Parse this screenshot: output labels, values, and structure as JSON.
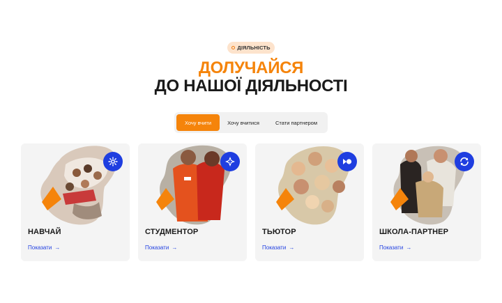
{
  "section": {
    "badge": "ДІЯЛЬНІСТЬ",
    "title_line1": "ДОЛУЧАЙСЯ",
    "title_line2": "ДО НАШОЇ ДІЯЛЬНОСТІ"
  },
  "tabs": [
    {
      "label": "Хочу вчити",
      "active": true
    },
    {
      "label": "Хочу вчитися",
      "active": false
    },
    {
      "label": "Стати партнером",
      "active": false
    }
  ],
  "cards": [
    {
      "title": "НАВЧАЙ",
      "link": "Показати",
      "icon": "flower-icon"
    },
    {
      "title": "СТУДМЕНТОР",
      "link": "Показати",
      "icon": "plus-star-icon"
    },
    {
      "title": "ТЬЮТОР",
      "link": "Показати",
      "icon": "bowtie-icon"
    },
    {
      "title": "ШКОЛА-ПАРТНЕР",
      "link": "Показати",
      "icon": "refresh-icon"
    }
  ],
  "colors": {
    "accent_orange": "#f5840b",
    "accent_blue": "#1f3ee0",
    "card_bg": "#f4f4f4"
  }
}
